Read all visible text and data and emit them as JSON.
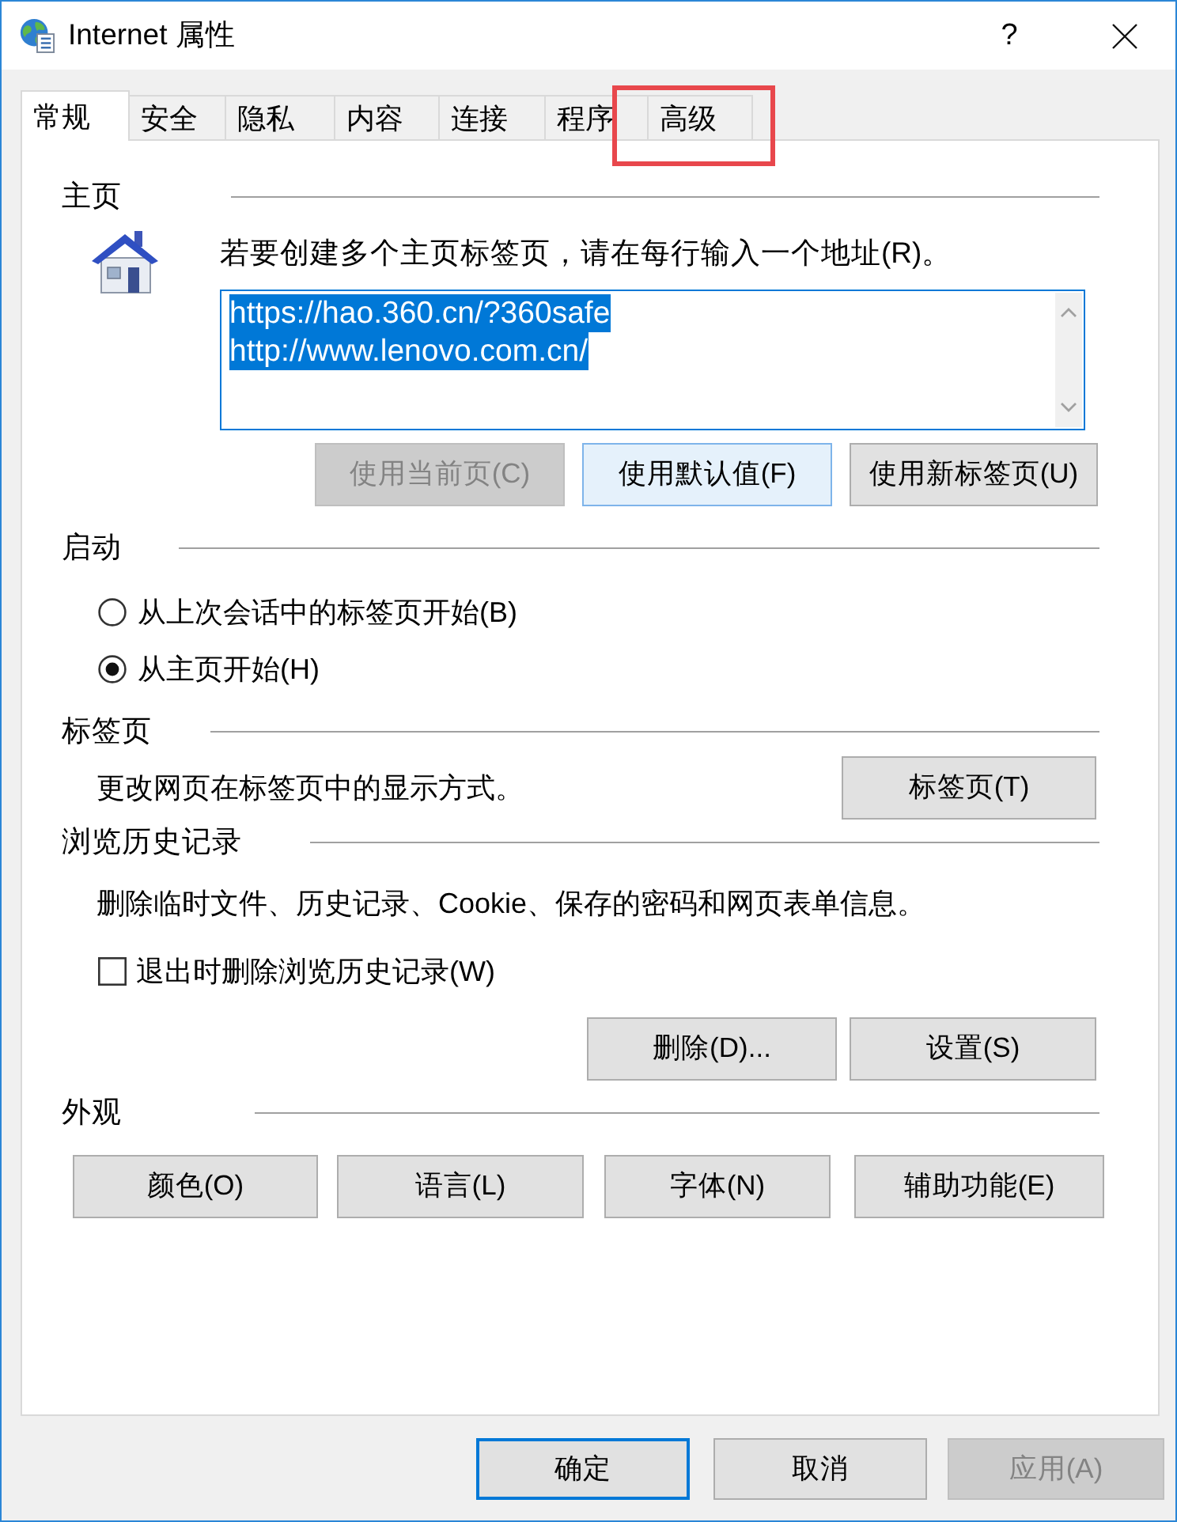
{
  "window": {
    "title": "Internet 属性",
    "help_button": "?"
  },
  "tabs": [
    {
      "label": "常规",
      "selected": true,
      "highlighted": false
    },
    {
      "label": "安全",
      "selected": false,
      "highlighted": false
    },
    {
      "label": "隐私",
      "selected": false,
      "highlighted": false
    },
    {
      "label": "内容",
      "selected": false,
      "highlighted": false
    },
    {
      "label": "连接",
      "selected": false,
      "highlighted": false
    },
    {
      "label": "程序",
      "selected": false,
      "highlighted": false
    },
    {
      "label": "高级",
      "selected": false,
      "highlighted": true
    }
  ],
  "home_page": {
    "heading": "主页",
    "instruction": "若要创建多个主页标签页，请在每行输入一个地址(R)。",
    "addresses": [
      {
        "text": "https://hao.360.cn/?360safe",
        "selected": true
      },
      {
        "text": "http://www.lenovo.com.cn/",
        "selected": true
      }
    ],
    "buttons": [
      {
        "label": "使用当前页(C)",
        "disabled": true,
        "hovered": false
      },
      {
        "label": "使用默认值(F)",
        "disabled": false,
        "hovered": true
      },
      {
        "label": "使用新标签页(U)",
        "disabled": false,
        "hovered": false
      }
    ]
  },
  "startup": {
    "heading": "启动",
    "options": [
      {
        "label": "从上次会话中的标签页开始(B)",
        "selected": false
      },
      {
        "label": "从主页开始(H)",
        "selected": true
      }
    ]
  },
  "tabs_section": {
    "heading": "标签页",
    "description": "更改网页在标签页中的显示方式。",
    "button": {
      "label": "标签页(T)"
    }
  },
  "browsing_history": {
    "heading": "浏览历史记录",
    "description": "删除临时文件、历史记录、Cookie、保存的密码和网页表单信息。",
    "checkbox": {
      "label": "退出时删除浏览历史记录(W)",
      "checked": false
    },
    "buttons": [
      {
        "label": "删除(D)..."
      },
      {
        "label": "设置(S)"
      }
    ]
  },
  "appearance": {
    "heading": "外观",
    "buttons": [
      {
        "label": "颜色(O)"
      },
      {
        "label": "语言(L)"
      },
      {
        "label": "字体(N)"
      },
      {
        "label": "辅助功能(E)"
      }
    ]
  },
  "footer_buttons": [
    {
      "label": "确定",
      "disabled": false,
      "default": true
    },
    {
      "label": "取消",
      "disabled": false,
      "default": false
    },
    {
      "label": "应用(A)",
      "disabled": true,
      "default": false
    }
  ]
}
